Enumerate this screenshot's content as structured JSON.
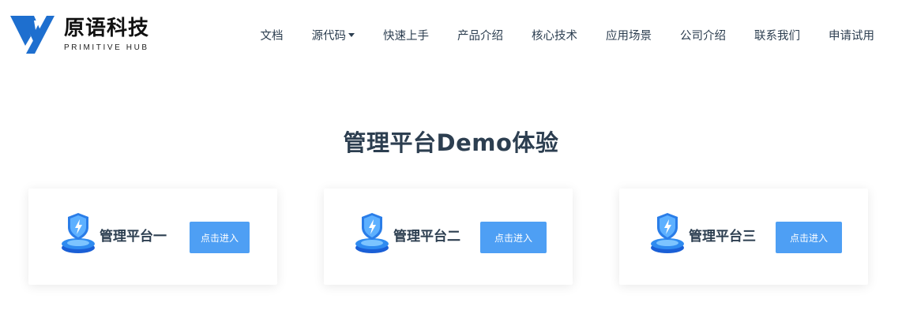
{
  "brand": {
    "name_cn": "原语科技",
    "name_en": "PRIMITIVE HUB",
    "color": "#1e6fcf"
  },
  "nav": {
    "items": [
      {
        "label": "文档"
      },
      {
        "label": "源代码",
        "dropdown": true
      },
      {
        "label": "快速上手"
      },
      {
        "label": "产品介绍"
      },
      {
        "label": "核心技术"
      },
      {
        "label": "应用场景"
      },
      {
        "label": "公司介绍"
      },
      {
        "label": "联系我们"
      },
      {
        "label": "申请试用"
      }
    ]
  },
  "section": {
    "title": "管理平台Demo体验"
  },
  "cards": [
    {
      "label": "管理平台一",
      "button": "点击进入",
      "icon": "shield-platform-icon"
    },
    {
      "label": "管理平台二",
      "button": "点击进入",
      "icon": "shield-platform-icon"
    },
    {
      "label": "管理平台三",
      "button": "点击进入",
      "icon": "shield-platform-icon"
    }
  ],
  "colors": {
    "accent": "#4e9ff4",
    "text": "#2c3e50"
  }
}
